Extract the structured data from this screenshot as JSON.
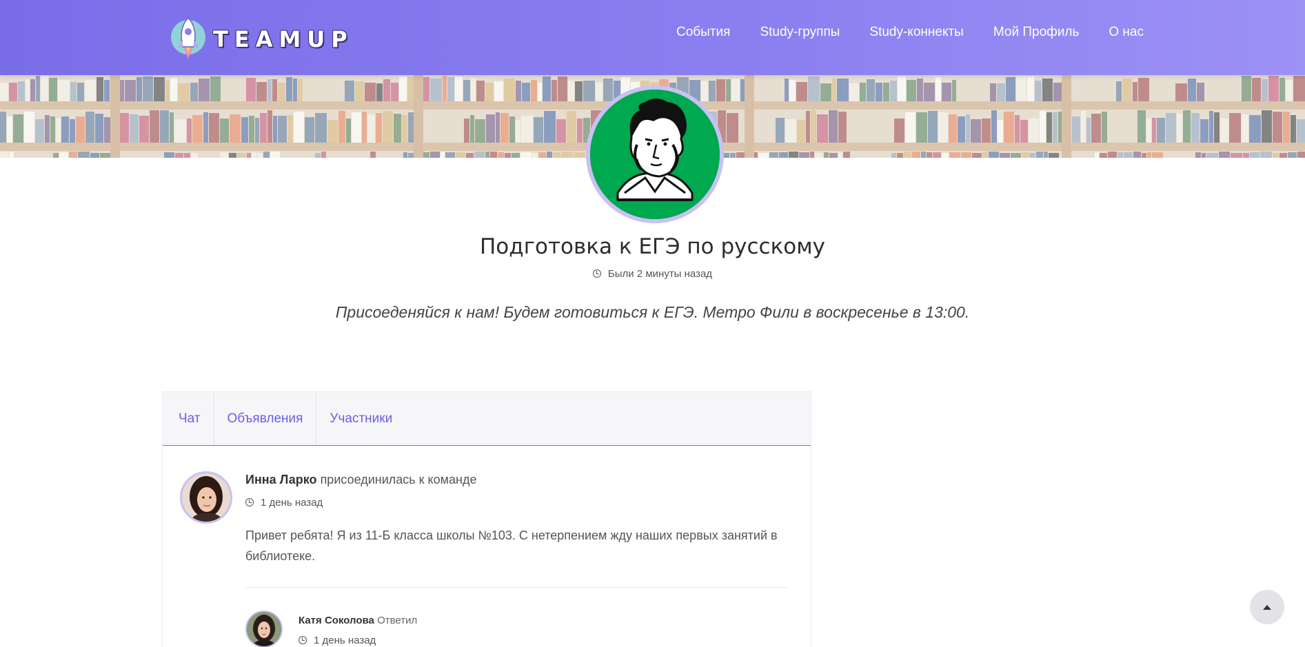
{
  "brand": {
    "logo_text": "TEAMUP"
  },
  "nav": {
    "items": [
      "События",
      "Study-группы",
      "Study-коннекты",
      "Мой Профиль",
      "О нас"
    ]
  },
  "group": {
    "title": "Подготовка к ЕГЭ по русскому",
    "last_seen": "Были 2 минуты назад",
    "description": "Присоеденяйся к нам! Будем готовиться к ЕГЭ. Метро Фили в воскресенье в 13:00."
  },
  "tabs": [
    "Чат",
    "Объявления",
    "Участники"
  ],
  "post": {
    "author": "Инна Ларко",
    "action": "присоединилась к команде",
    "time": "1 день назад",
    "text": "Привет ребята! Я из 11-Б класса школы №103. С нетерпением жду наших первых занятий в библиотеке."
  },
  "reply": {
    "author": "Катя Соколова",
    "action": "Ответил",
    "time": "1 день назад"
  },
  "icons": {
    "clock": "clock-icon",
    "scroll_top": "arrow-up-icon"
  },
  "colors": {
    "accent": "#7b6ee6",
    "header_start": "#7a6de8",
    "header_end": "#9c91f5",
    "avatar_bg": "#00a84f"
  }
}
